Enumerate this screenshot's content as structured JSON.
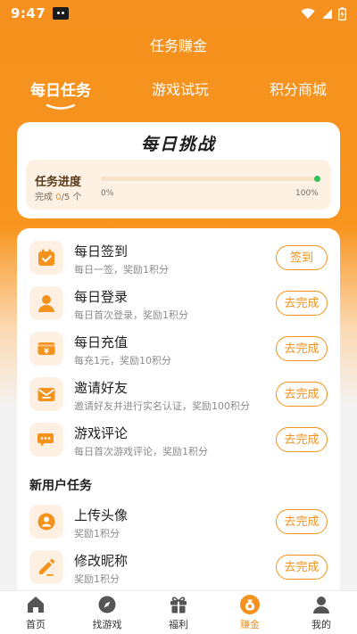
{
  "status_bar": {
    "time": "9:47"
  },
  "header": {
    "title": "任务赚金"
  },
  "tabs": [
    {
      "label": "每日任务",
      "active": true
    },
    {
      "label": "游戏试玩",
      "active": false
    },
    {
      "label": "积分商城",
      "active": false
    }
  ],
  "challenge": {
    "title": "每日挑战",
    "progress_label": "任务进度",
    "done_prefix": "完成",
    "done_count": "0",
    "done_total": "/5 个",
    "min_label": "0%",
    "max_label": "100%",
    "progress": 0
  },
  "daily_tasks": [
    {
      "name": "每日签到",
      "desc": "每日一签，奖励1积分",
      "button": "签到",
      "icon": "calendar-check-icon"
    },
    {
      "name": "每日登录",
      "desc": "每日首次登录，奖励1积分",
      "button": "去完成",
      "icon": "user-icon"
    },
    {
      "name": "每日充值",
      "desc": "每充1元，奖励10积分",
      "button": "去完成",
      "icon": "yen-card-icon"
    },
    {
      "name": "邀请好友",
      "desc": "邀请好友并进行实名认证，奖励100积分",
      "button": "去完成",
      "icon": "envelope-icon"
    },
    {
      "name": "游戏评论",
      "desc": "每日首次游戏评论，奖励1积分",
      "button": "去完成",
      "icon": "chat-bubble-icon"
    }
  ],
  "new_user_section": {
    "title": "新用户任务"
  },
  "new_user_tasks": [
    {
      "name": "上传头像",
      "desc": "奖励1积分",
      "button": "去完成",
      "icon": "avatar-upload-icon"
    },
    {
      "name": "修改昵称",
      "desc": "奖励1积分",
      "button": "去完成",
      "icon": "pencil-icon"
    }
  ],
  "bottom_nav": [
    {
      "label": "首页",
      "icon": "home-icon",
      "active": false
    },
    {
      "label": "找游戏",
      "icon": "compass-icon",
      "active": false
    },
    {
      "label": "福利",
      "icon": "gift-icon",
      "active": false
    },
    {
      "label": "赚金",
      "icon": "coin-bag-icon",
      "active": true
    },
    {
      "label": "我的",
      "icon": "profile-icon",
      "active": false
    }
  ],
  "colors": {
    "accent": "#f3921d",
    "progress_dot": "#2fc45b"
  }
}
